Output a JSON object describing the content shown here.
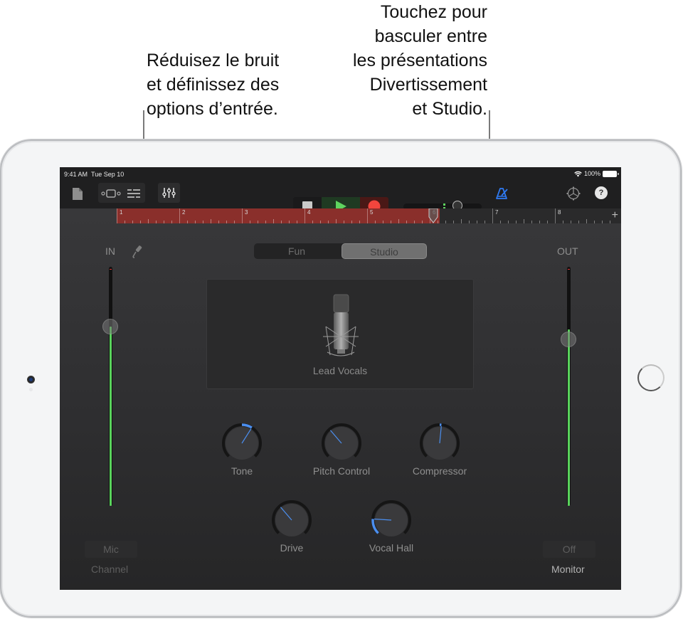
{
  "callouts": {
    "left": [
      "Réduisez le bruit",
      "et définissez des",
      "options d’entrée."
    ],
    "right": [
      "Touchez pour",
      "basculer entre",
      "les présentations",
      "Divertissement",
      "et Studio."
    ]
  },
  "status_bar": {
    "time": "9:41 AM",
    "date": "Tue Sep 10",
    "battery": "100%",
    "wifi_icon": "wifi-icon",
    "battery_icon": "battery-icon"
  },
  "toolbar": {
    "icons": [
      "document-icon",
      "view-toggle-icon",
      "tracks-view-icon",
      "mixer-icon",
      "stop-icon",
      "play-icon",
      "record-icon",
      "metronome-icon",
      "settings-icon",
      "help-icon"
    ],
    "help_label": "?",
    "master_volume": 0.72,
    "colors": {
      "play": "#5fd45f",
      "record": "#f2453d",
      "metronome": "#2f7bf5"
    }
  },
  "ruler": {
    "bars": [
      "1",
      "2",
      "3",
      "4",
      "5",
      "6",
      "7",
      "8"
    ],
    "add_label": "+",
    "region_color": "#8a2f2b",
    "playhead_bar": 6
  },
  "input": {
    "label": "IN",
    "level": 0.75,
    "icon": "input-settings-icon",
    "channel_button": "Mic",
    "channel_label": "Channel"
  },
  "output": {
    "label": "OUT",
    "level": 0.7,
    "monitor_button": "Off",
    "monitor_label": "Monitor"
  },
  "view_toggle": {
    "options": [
      "Fun",
      "Studio"
    ],
    "selected": "Studio"
  },
  "patch": {
    "name": "Lead Vocals",
    "icon": "microphone-icon"
  },
  "knobs": [
    {
      "label": "Tone",
      "value": 0.62
    },
    {
      "label": "Pitch Control",
      "value": 0.35
    },
    {
      "label": "Compressor",
      "value": 0.52
    },
    {
      "label": "Drive",
      "value": 0.35
    },
    {
      "label": "Vocal Hall",
      "value": 0.18
    }
  ],
  "accent_color": "#4b8ff0"
}
